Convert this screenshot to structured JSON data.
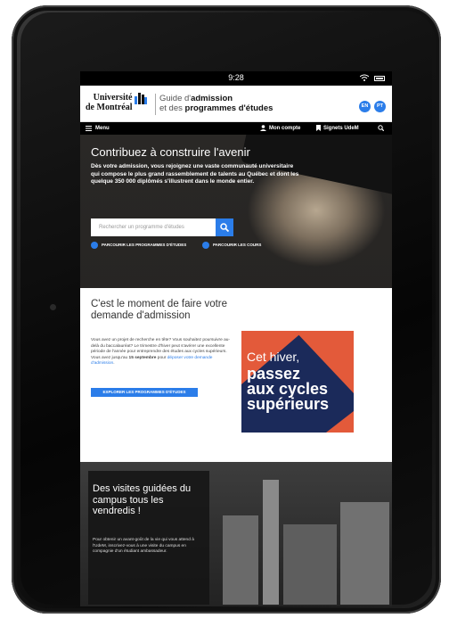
{
  "status_bar": {
    "time": "9:28"
  },
  "header": {
    "university_line1": "Université",
    "university_line2": "de Montréal",
    "guide_line1_prefix": "Guide d'",
    "guide_line1_bold": "admission",
    "guide_line2_prefix": "et des ",
    "guide_line2_bold": "programmes d'études",
    "lang_en": "EN",
    "lang_pt": "PT"
  },
  "navbar": {
    "menu": "Menu",
    "account": "Mon compte",
    "bookmarks": "Signets UdeM"
  },
  "hero": {
    "title": "Contribuez à construire l'avenir",
    "text": "Dès votre admission, vous rejoignez une vaste communauté universitaire qui compose le plus grand rassemblement de talents au Québec et dont les quelque 350 000 diplômés s'illustrent dans le monde entier.",
    "search_placeholder": "Rechercher un programme d'études",
    "link_programs": "PARCOURIR LES PROGRAMMES D'ÉTUDES",
    "link_courses": "PARCOURIR LES COURS"
  },
  "moment": {
    "title": "C'est le moment de faire votre demande d'admission",
    "text_before": "Vous avez un projet de recherche en tête? Vous souhaitez poursuivre au-delà du baccalauréat? Le trimestre d'hiver peut s'avérer une excellente période de l'année pour entreprendre des études aux cycles supérieurs. Vous avez jusqu'au ",
    "text_date": "15 septembre",
    "text_mid": " pour ",
    "text_link": "déposer votre demande d'admission",
    "text_end": ".",
    "button": "EXPLORER LES PROGRAMMES D'ÉTUDES",
    "promo_line1": "Cet hiver,",
    "promo_line2": "passez",
    "promo_line3": "aux cycles",
    "promo_line4": "supérieurs",
    "promo_colors": {
      "navy": "#1b2a5a",
      "orange": "#e35a3a"
    }
  },
  "campus": {
    "title": "Des visites guidées du campus tous les vendredis !",
    "text": "Pour obtenir un avant-goût de la vie qui vous attend à l'UdeM, inscrivez-vous à une visite du campus en compagnie d'un étudiant ambassadeur."
  },
  "colors": {
    "accent": "#2b7de9",
    "nav_bg": "#000000"
  }
}
